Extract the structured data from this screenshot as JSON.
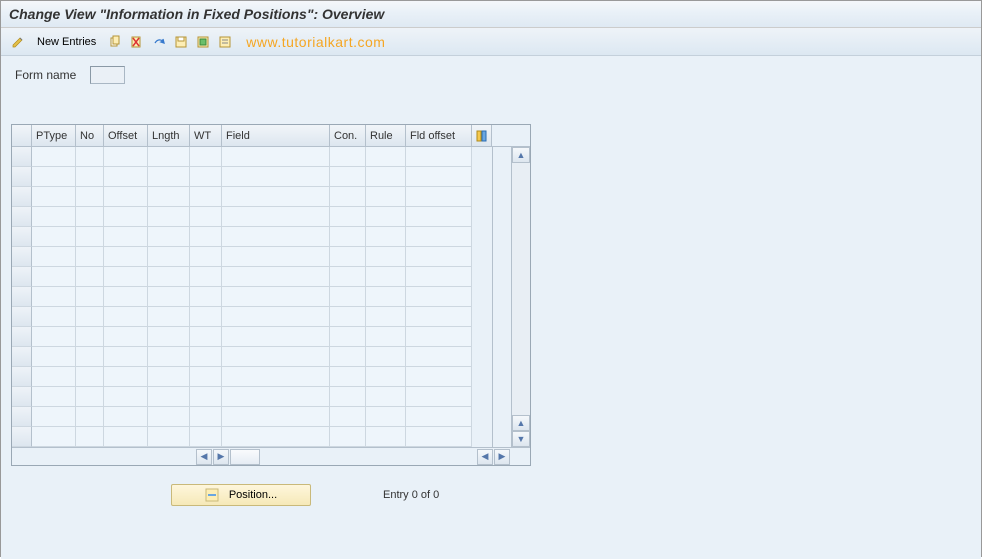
{
  "title": "Change View \"Information in Fixed Positions\": Overview",
  "toolbar": {
    "new_entries_label": "New Entries"
  },
  "watermark": "www.tutorialkart.com",
  "form": {
    "form_name_label": "Form name",
    "form_name_value": ""
  },
  "table": {
    "columns": {
      "ptype": "PType",
      "no": "No",
      "offset": "Offset",
      "lngth": "Lngth",
      "wt": "WT",
      "field": "Field",
      "con": "Con.",
      "rule": "Rule",
      "fld_offset": "Fld offset"
    },
    "rows": []
  },
  "footer": {
    "position_label": "Position...",
    "entry_text": "Entry 0 of 0"
  }
}
